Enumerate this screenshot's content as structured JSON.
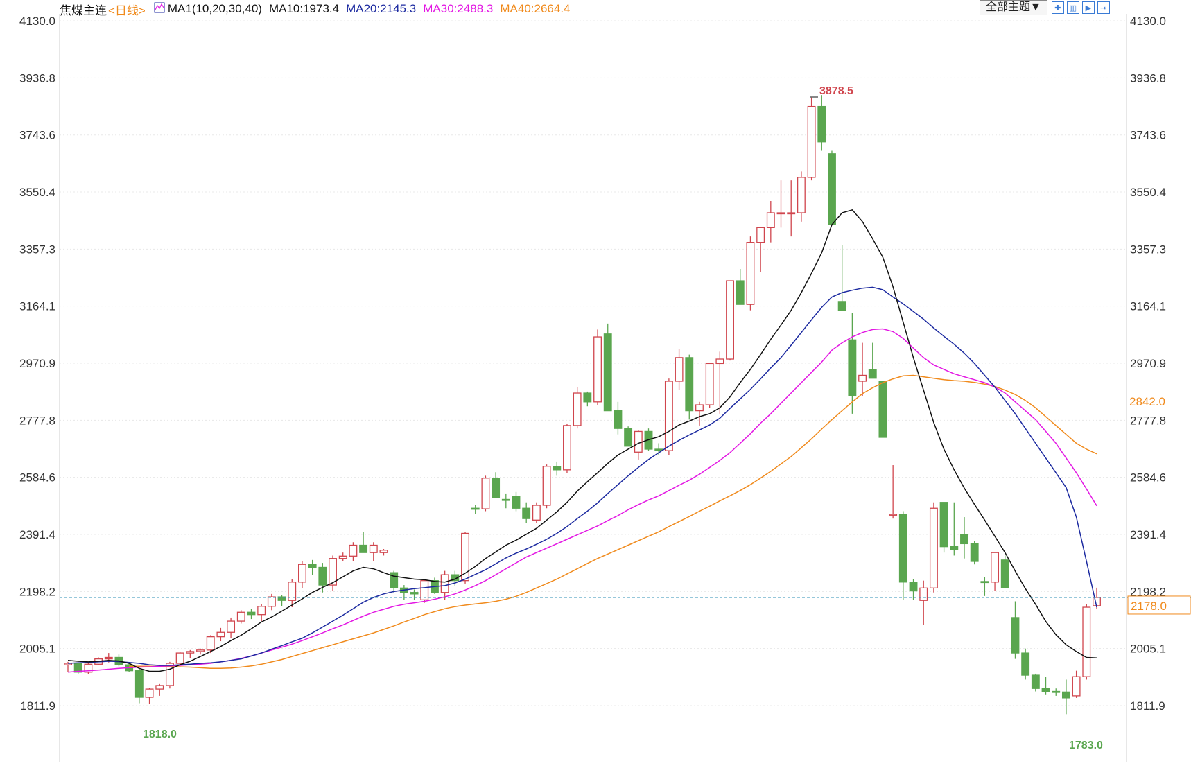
{
  "header": {
    "symbol": "焦煤主连",
    "period": "<日线>",
    "indicator": "MA1(10,20,30,40)",
    "ma10_label": "MA10:1973.4",
    "ma20_label": "MA20:2145.3",
    "ma30_label": "MA30:2488.3",
    "ma40_label": "MA40:2664.4"
  },
  "toolbar": {
    "theme_button": "全部主题▼",
    "icons": [
      "grid-icon",
      "layout-icon",
      "play-icon",
      "forward-icon"
    ]
  },
  "colors": {
    "up": "#d0454d",
    "down": "#5aa64f",
    "ma10": "#111111",
    "ma20": "#1c2aa0",
    "ma30": "#e317e3",
    "ma40": "#f08a1c",
    "current_line": "#2e8fb5",
    "price_tag": "#f08a1c"
  },
  "chart_data": {
    "type": "candlestick",
    "y_ticks": [
      "4130.0",
      "3936.8",
      "3743.6",
      "3550.4",
      "3357.3",
      "3164.1",
      "2970.9",
      "2777.8",
      "2584.6",
      "2391.4",
      "2198.2",
      "2005.1",
      "1811.9"
    ],
    "ylim": [
      1811.9,
      4130.0
    ],
    "grid": true,
    "annotations": {
      "high": "3878.5",
      "low_left": "1818.0",
      "low_right": "1783.0"
    },
    "current_price": "2178.0",
    "right_tag_ma40": "2842.0",
    "current_value": 2178.0,
    "ma40_last": 2842.0,
    "candles": [
      [
        1950,
        1960,
        1925,
        1955
      ],
      [
        1955,
        1958,
        1920,
        1925
      ],
      [
        1925,
        1958,
        1918,
        1952
      ],
      [
        1952,
        1975,
        1948,
        1970
      ],
      [
        1970,
        1990,
        1958,
        1975
      ],
      [
        1975,
        1985,
        1945,
        1950
      ],
      [
        1950,
        1958,
        1926,
        1930
      ],
      [
        1930,
        1938,
        1820,
        1840
      ],
      [
        1840,
        1872,
        1818,
        1868
      ],
      [
        1868,
        1885,
        1845,
        1880
      ],
      [
        1880,
        1960,
        1870,
        1955
      ],
      [
        1955,
        1995,
        1945,
        1990
      ],
      [
        1990,
        2000,
        1972,
        1995
      ],
      [
        1995,
        2005,
        1985,
        2000
      ],
      [
        2000,
        2050,
        1990,
        2045
      ],
      [
        2045,
        2075,
        2030,
        2060
      ],
      [
        2060,
        2110,
        2040,
        2098
      ],
      [
        2098,
        2135,
        2090,
        2128
      ],
      [
        2128,
        2140,
        2105,
        2120
      ],
      [
        2120,
        2155,
        2098,
        2148
      ],
      [
        2148,
        2190,
        2135,
        2180
      ],
      [
        2180,
        2185,
        2148,
        2168
      ],
      [
        2168,
        2240,
        2145,
        2230
      ],
      [
        2230,
        2300,
        2210,
        2290
      ],
      [
        2290,
        2305,
        2255,
        2280
      ],
      [
        2280,
        2295,
        2195,
        2220
      ],
      [
        2220,
        2320,
        2200,
        2310
      ],
      [
        2310,
        2330,
        2300,
        2318
      ],
      [
        2318,
        2365,
        2300,
        2355
      ],
      [
        2355,
        2400,
        2330,
        2330
      ],
      [
        2330,
        2365,
        2300,
        2355
      ],
      [
        2330,
        2342,
        2320,
        2338
      ],
      [
        2262,
        2268,
        2195,
        2210
      ],
      [
        2210,
        2220,
        2170,
        2195
      ],
      [
        2195,
        2205,
        2170,
        2190
      ],
      [
        2170,
        2240,
        2160,
        2235
      ],
      [
        2235,
        2245,
        2190,
        2195
      ],
      [
        2195,
        2268,
        2170,
        2255
      ],
      [
        2255,
        2268,
        2218,
        2235
      ],
      [
        2235,
        2400,
        2225,
        2395
      ],
      [
        2480,
        2490,
        2460,
        2478
      ],
      [
        2478,
        2590,
        2470,
        2582
      ],
      [
        2582,
        2602,
        2525,
        2515
      ],
      [
        2510,
        2530,
        2480,
        2508
      ],
      [
        2520,
        2535,
        2470,
        2480
      ],
      [
        2480,
        2500,
        2430,
        2445
      ],
      [
        2440,
        2500,
        2430,
        2490
      ],
      [
        2490,
        2628,
        2480,
        2622
      ],
      [
        2622,
        2638,
        2590,
        2610
      ],
      [
        2610,
        2765,
        2600,
        2760
      ],
      [
        2760,
        2890,
        2750,
        2870
      ],
      [
        2870,
        2875,
        2825,
        2840
      ],
      [
        2840,
        3085,
        2830,
        3060
      ],
      [
        3070,
        3105,
        2815,
        2810
      ],
      [
        2810,
        2840,
        2730,
        2750
      ],
      [
        2750,
        2757,
        2690,
        2690
      ],
      [
        2670,
        2744,
        2645,
        2740
      ],
      [
        2740,
        2750,
        2673,
        2680
      ],
      [
        2680,
        2700,
        2660,
        2675
      ],
      [
        2675,
        2919,
        2660,
        2910
      ],
      [
        2910,
        3020,
        2880,
        2990
      ],
      [
        2990,
        3000,
        2780,
        2810
      ],
      [
        2810,
        2840,
        2760,
        2830
      ],
      [
        2830,
        2970,
        2820,
        2970
      ],
      [
        2970,
        3010,
        2800,
        2985
      ],
      [
        2985,
        3250,
        2980,
        3250
      ],
      [
        3250,
        3290,
        3170,
        3170
      ],
      [
        3170,
        3400,
        3150,
        3380
      ],
      [
        3380,
        3430,
        3280,
        3430
      ],
      [
        3430,
        3520,
        3380,
        3480
      ],
      [
        3480,
        3590,
        3430,
        3480
      ],
      [
        3480,
        3590,
        3400,
        3480
      ],
      [
        3480,
        3620,
        3450,
        3600
      ],
      [
        3600,
        3870,
        3590,
        3840
      ],
      [
        3840,
        3878.5,
        3690,
        3720
      ],
      [
        3680,
        3690,
        3440,
        3440
      ],
      [
        3180,
        3370,
        3150,
        3150
      ],
      [
        3050,
        3140,
        2800,
        2860
      ],
      [
        2910,
        3040,
        2860,
        2930
      ],
      [
        2950,
        3040,
        2940,
        2920
      ],
      [
        2910,
        2910,
        2720,
        2720
      ],
      [
        2458,
        2626,
        2445,
        2460
      ],
      [
        2460,
        2470,
        2170,
        2230
      ],
      [
        2230,
        2240,
        2170,
        2200
      ],
      [
        2168,
        2235,
        2085,
        2210
      ],
      [
        2210,
        2500,
        2195,
        2480
      ],
      [
        2500,
        2500,
        2330,
        2350
      ],
      [
        2350,
        2500,
        2320,
        2340
      ],
      [
        2390,
        2450,
        2310,
        2360
      ],
      [
        2360,
        2370,
        2290,
        2300
      ],
      [
        2232,
        2248,
        2183,
        2230
      ],
      [
        2230,
        2305,
        2200,
        2330
      ],
      [
        2305,
        2320,
        2210,
        2210
      ],
      [
        2110,
        2165,
        1970,
        1990
      ],
      [
        1990,
        2005,
        1900,
        1915
      ],
      [
        1915,
        1920,
        1860,
        1870
      ],
      [
        1870,
        1910,
        1850,
        1860
      ],
      [
        1860,
        1870,
        1845,
        1858
      ],
      [
        1858,
        1900,
        1783,
        1838
      ],
      [
        1845,
        1930,
        1838,
        1910
      ],
      [
        1910,
        2155,
        1900,
        2145
      ],
      [
        2150,
        2211,
        2140,
        2178
      ]
    ],
    "ma10": [
      1965,
      1962,
      1960,
      1962,
      1965,
      1963,
      1955,
      1938,
      1928,
      1928,
      1935,
      1950,
      1962,
      1978,
      1995,
      2012,
      2032,
      2050,
      2072,
      2095,
      2112,
      2132,
      2152,
      2173,
      2195,
      2212,
      2228,
      2248,
      2268,
      2280,
      2275,
      2262,
      2250,
      2245,
      2240,
      2238,
      2232,
      2230,
      2240,
      2260,
      2283,
      2310,
      2332,
      2355,
      2372,
      2392,
      2412,
      2440,
      2468,
      2500,
      2538,
      2570,
      2600,
      2632,
      2660,
      2680,
      2700,
      2712,
      2722,
      2740,
      2762,
      2775,
      2790,
      2800,
      2820,
      2857,
      2905,
      2950,
      3000,
      3052,
      3100,
      3150,
      3210,
      3275,
      3345,
      3440,
      3480,
      3490,
      3450,
      3392,
      3330,
      3230,
      3110,
      2990,
      2880,
      2770,
      2680,
      2610,
      2548,
      2493,
      2440,
      2385,
      2330,
      2267,
      2208,
      2155,
      2097,
      2052,
      2018,
      1995,
      1975,
      1973.4
    ],
    "ma20": [
      1955,
      1957,
      1958,
      1960,
      1962,
      1961,
      1958,
      1955,
      1950,
      1948,
      1948,
      1950,
      1952,
      1955,
      1957,
      1960,
      1965,
      1970,
      1980,
      1990,
      2003,
      2015,
      2028,
      2040,
      2058,
      2078,
      2098,
      2118,
      2140,
      2162,
      2178,
      2190,
      2198,
      2203,
      2208,
      2211,
      2215,
      2218,
      2227,
      2240,
      2256,
      2272,
      2292,
      2312,
      2328,
      2342,
      2358,
      2375,
      2395,
      2418,
      2445,
      2470,
      2498,
      2530,
      2560,
      2590,
      2618,
      2645,
      2668,
      2690,
      2710,
      2728,
      2745,
      2762,
      2785,
      2818,
      2850,
      2882,
      2918,
      2955,
      2990,
      3032,
      3075,
      3118,
      3160,
      3195,
      3210,
      3218,
      3225,
      3228,
      3220,
      3195,
      3172,
      3146,
      3120,
      3090,
      3062,
      3035,
      3005,
      2970,
      2930,
      2890,
      2845,
      2800,
      2750,
      2700,
      2650,
      2600,
      2550,
      2450,
      2300,
      2145.3
    ],
    "ma30": [
      1925,
      1928,
      1930,
      1932,
      1935,
      1938,
      1940,
      1942,
      1943,
      1945,
      1946,
      1948,
      1950,
      1952,
      1955,
      1960,
      1965,
      1972,
      1980,
      1990,
      2000,
      2010,
      2020,
      2032,
      2045,
      2058,
      2072,
      2085,
      2100,
      2115,
      2128,
      2138,
      2148,
      2155,
      2160,
      2165,
      2172,
      2180,
      2190,
      2203,
      2218,
      2235,
      2255,
      2275,
      2295,
      2315,
      2330,
      2345,
      2360,
      2375,
      2390,
      2405,
      2420,
      2438,
      2455,
      2475,
      2492,
      2508,
      2522,
      2540,
      2558,
      2575,
      2595,
      2618,
      2642,
      2668,
      2700,
      2732,
      2768,
      2800,
      2835,
      2870,
      2905,
      2940,
      2975,
      3015,
      3040,
      3060,
      3075,
      3085,
      3087,
      3078,
      3055,
      3022,
      2990,
      2965,
      2950,
      2935,
      2925,
      2915,
      2905,
      2890,
      2870,
      2840,
      2810,
      2780,
      2740,
      2700,
      2650,
      2600,
      2545,
      2488.3
    ],
    "ma40": [
      1945,
      1945,
      1945,
      1944,
      1944,
      1943,
      1942,
      1940,
      1938,
      1938,
      1939,
      1942,
      1946,
      1952,
      1960,
      1968,
      1978,
      1988,
      1998,
      2008,
      2018,
      2028,
      2038,
      2048,
      2058,
      2070,
      2082,
      2095,
      2107,
      2120,
      2130,
      2140,
      2147,
      2152,
      2156,
      2160,
      2165,
      2172,
      2182,
      2195,
      2210,
      2225,
      2240,
      2258,
      2275,
      2293,
      2310,
      2325,
      2340,
      2355,
      2370,
      2385,
      2400,
      2418,
      2435,
      2452,
      2470,
      2487,
      2505,
      2522,
      2540,
      2560,
      2582,
      2605,
      2630,
      2655,
      2685,
      2715,
      2748,
      2780,
      2810,
      2840,
      2868,
      2888,
      2905,
      2918,
      2928,
      2930,
      2925,
      2920,
      2915,
      2912,
      2910,
      2906,
      2900,
      2892,
      2880,
      2865,
      2845,
      2820,
      2790,
      2760,
      2730,
      2700,
      2680,
      2664.4
    ]
  }
}
